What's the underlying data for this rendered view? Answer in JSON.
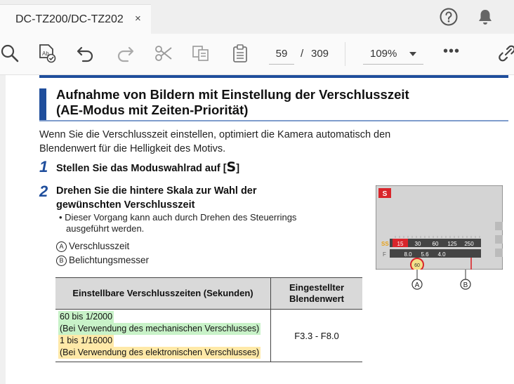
{
  "tab": {
    "title": "DC-TZ200/DC-TZ202",
    "close": "×"
  },
  "toolbar": {
    "page_current": "59",
    "page_separator": "/",
    "page_total": "309",
    "zoom": "109%",
    "more": "•••"
  },
  "doc": {
    "heading_line1": "Aufnahme von Bildern mit Einstellung der Verschlusszeit",
    "heading_line2": "(AE-Modus mit Zeiten-Priorität)",
    "intro_line1": "Wenn Sie die Verschlusszeit einstellen, optimiert die Kamera automatisch den",
    "intro_line2": "Blendenwert für die Helligkeit des Motivs.",
    "step1_num": "1",
    "step1_text": "Stellen Sie das Moduswahlrad auf [",
    "step1_symbol": "S",
    "step1_close": "]",
    "step2_num": "2",
    "step2_line1": "Drehen Sie die hintere Skala zur Wahl der",
    "step2_line2": "gewünschten Verschlusszeit",
    "bullet_line1": "• Dieser Vorgang kann auch durch Drehen des Steuerrings",
    "bullet_line2": "ausgeführt werden.",
    "legend_a_mark": "A",
    "legend_a": "Verschlusszeit",
    "legend_b_mark": "B",
    "legend_b": "Belichtungsmesser",
    "table": {
      "col1": "Einstellbare Verschlusszeiten (Sekunden)",
      "col2_line1": "Eingestellter",
      "col2_line2": "Blendenwert",
      "r1": "60 bis 1/2000",
      "r2": "(Bei Verwendung des mechanischen Verschlusses)",
      "r3": "1 bis 1/16000",
      "r4": "(Bei Verwendung des elektronischen Verschlusses)",
      "value": "F3.3 - F8.0"
    },
    "camera": {
      "mode": "S",
      "ss_label": "SS",
      "f_label": "F",
      "ss_values": [
        "15",
        "30",
        "60",
        "125",
        "250"
      ],
      "f_values": [
        "8.0",
        "5.6",
        "4.0"
      ],
      "current": "60",
      "callout_a": "A",
      "callout_b": "B"
    }
  },
  "colors": {
    "accent": "#1f4e9c",
    "green_highlight": "#c8f2c8",
    "yellow_highlight": "#ffe9a8",
    "red": "#d9252b"
  }
}
